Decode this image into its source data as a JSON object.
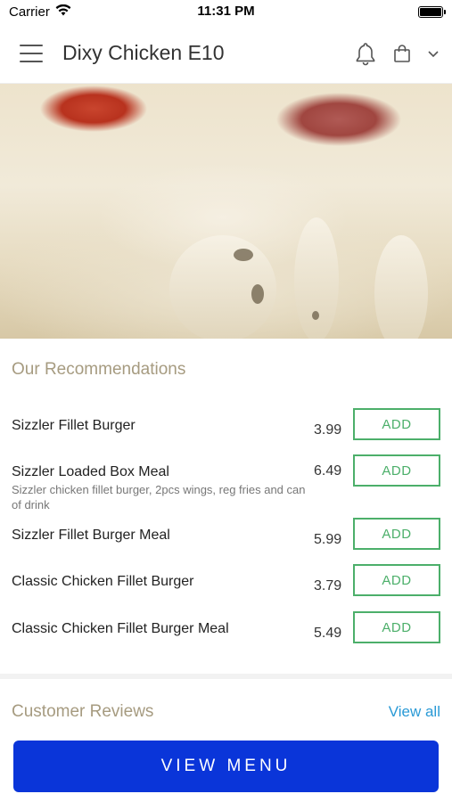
{
  "status_bar": {
    "carrier": "Carrier",
    "time": "11:31 PM"
  },
  "header": {
    "title": "Dixy Chicken E10",
    "icons": [
      "menu-icon",
      "bell-icon",
      "shopping-bag-icon",
      "chevron-down-icon"
    ]
  },
  "hero": {
    "image": "cheese-pizza-closeup"
  },
  "recommendations": {
    "title": "Our Recommendations",
    "items": [
      {
        "name": "Sizzler Fillet Burger",
        "description": "",
        "price": "3.99",
        "button": "ADD"
      },
      {
        "name": "Sizzler Loaded Box Meal",
        "description": "Sizzler chicken fillet burger, 2pcs wings, reg fries and can of drink",
        "price": "6.49",
        "button": "ADD"
      },
      {
        "name": "Sizzler Fillet Burger Meal",
        "description": "",
        "price": "5.99",
        "button": "ADD"
      },
      {
        "name": "Classic Chicken Fillet Burger",
        "description": "",
        "price": "3.79",
        "button": "ADD"
      },
      {
        "name": "Classic Chicken Fillet Burger Meal",
        "description": "",
        "price": "5.49",
        "button": "ADD"
      }
    ]
  },
  "reviews": {
    "title": "Customer Reviews",
    "view_all": "View all"
  },
  "footer": {
    "view_menu": "VIEW MENU"
  },
  "colors": {
    "accent_blue": "#0a35d9",
    "add_green": "#4caf6a",
    "link_blue": "#2a9ad6",
    "section_title": "#a69b80"
  }
}
